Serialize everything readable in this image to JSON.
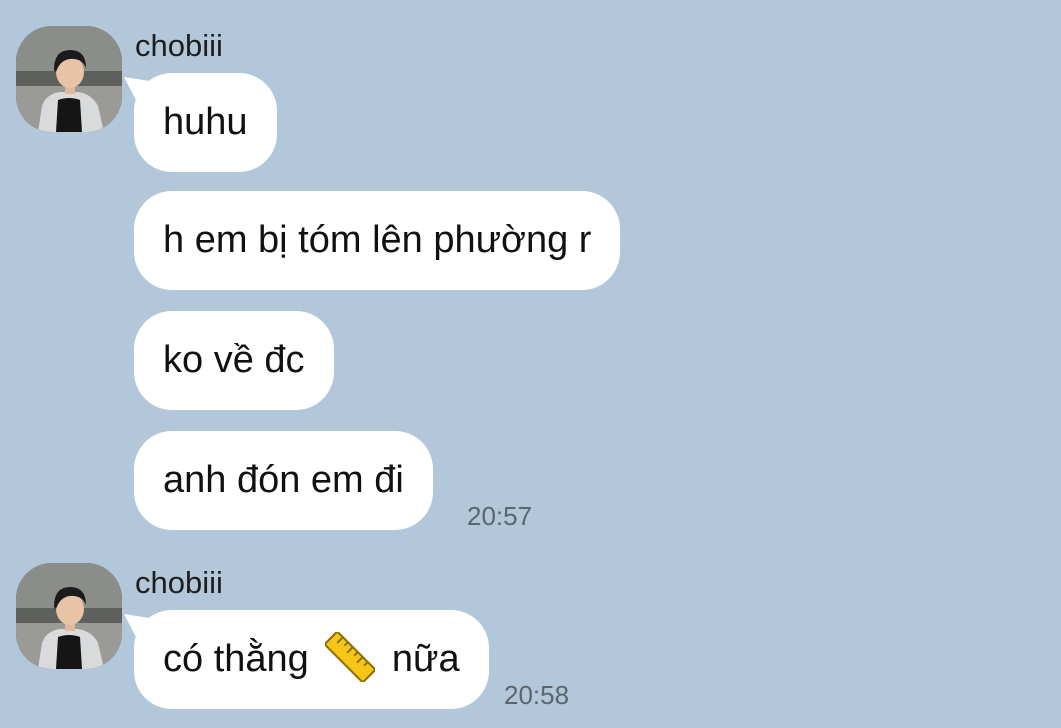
{
  "messages": {
    "group1": {
      "sender": "chobiii",
      "bubbles": [
        "huhu",
        "h em bị tóm lên phường r",
        "ko về đc",
        "anh đón em đi"
      ],
      "time": "20:57"
    },
    "group2": {
      "sender": "chobiii",
      "text_before": "có thằng",
      "emoji": "ruler-icon",
      "text_after": "nữa",
      "time": "20:58"
    }
  },
  "colors": {
    "chat_background": "#b2c7d9",
    "bubble": "#ffffff",
    "time_text": "#5b6670",
    "emoji_ruler": "#f5c518"
  }
}
